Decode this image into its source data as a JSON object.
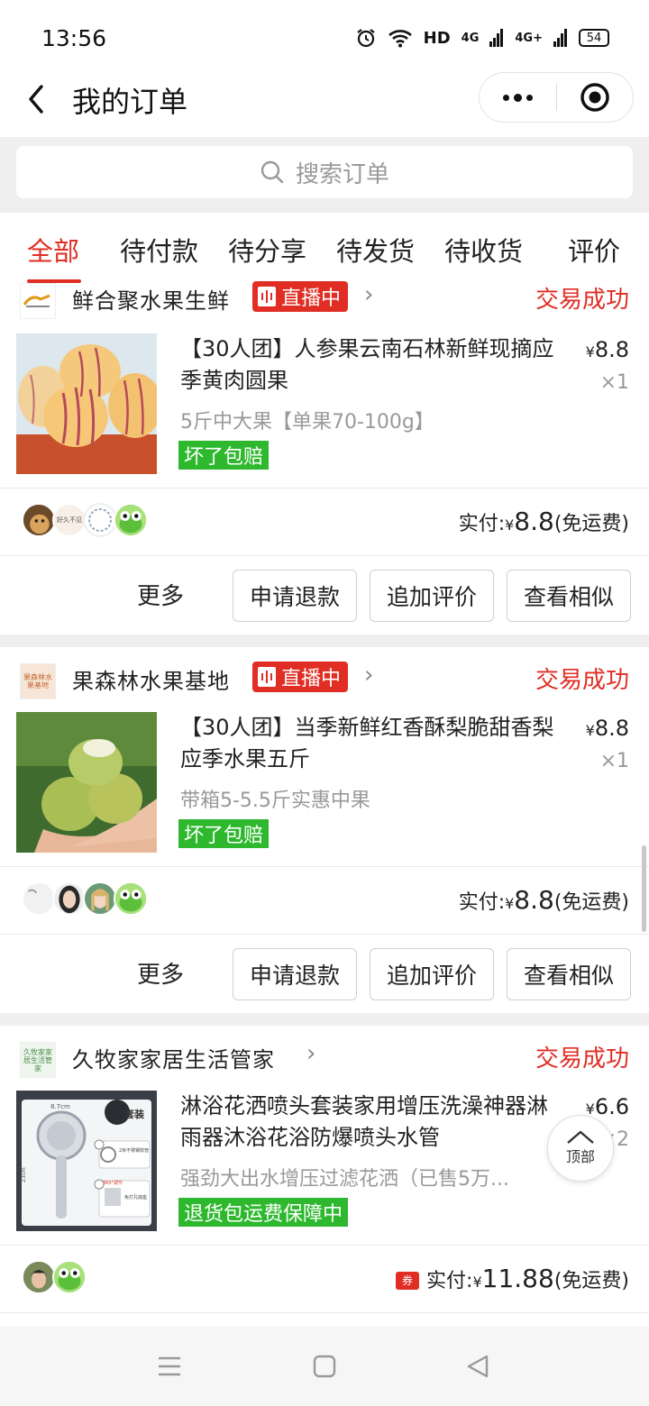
{
  "status_bar": {
    "time": "13:56",
    "hd": "HD",
    "net1": "4G",
    "net2": "4G+",
    "battery": "54"
  },
  "header": {
    "title": "我的订单"
  },
  "search": {
    "placeholder": "搜索订单"
  },
  "tabs": [
    {
      "label": "全部",
      "active": true
    },
    {
      "label": "待付款"
    },
    {
      "label": "待分享"
    },
    {
      "label": "待发货"
    },
    {
      "label": "待收货"
    },
    {
      "label": "评价"
    }
  ],
  "orders": [
    {
      "shop_name": "鲜合聚水果生鲜",
      "live_label": "直播中",
      "status": "交易成功",
      "title": "【30人团】人参果云南石林新鲜现摘应季黄肉圆果",
      "price_symbol": "¥",
      "price": "8.8",
      "qty": "×1",
      "spec": "5斤中大果【单果70-100g】",
      "tag": "坏了包赔",
      "paid_label": "实付:",
      "paid_amount": "8.8",
      "shipping": "(免运费)",
      "avatar_texts": [
        "",
        "好久不见",
        "",
        ""
      ],
      "buttons": {
        "more": "更多",
        "b1": "申请退款",
        "b2": "追加评价",
        "b3": "查看相似"
      }
    },
    {
      "shop_name": "果森林水果基地",
      "live_label": "直播中",
      "status": "交易成功",
      "title": "【30人团】当季新鲜红香酥梨脆甜香梨应季水果五斤",
      "price_symbol": "¥",
      "price": "8.8",
      "qty": "×1",
      "spec": "带箱5-5.5斤实惠中果",
      "tag": "坏了包赔",
      "paid_label": "实付:",
      "paid_amount": "8.8",
      "shipping": "(免运费)",
      "logo_text": "果森林水果基地",
      "buttons": {
        "more": "更多",
        "b1": "申请退款",
        "b2": "追加评价",
        "b3": "查看相似"
      }
    },
    {
      "shop_name": "久牧家家居生活管家",
      "logo_text": "久牧家家居生活管家",
      "status": "交易成功",
      "title": "淋浴花洒喷头套装家用增压洗澡神器淋雨器沐浴花浴防爆喷头水管",
      "price_symbol": "¥",
      "price": "6.6",
      "qty": "×2",
      "spec": "强劲大出水增压过滤花洒（已售5万...",
      "tag": "退货包运费保障中",
      "coupon": "券",
      "paid_label": "实付:",
      "paid_amount": "11.88",
      "shipping": "(免运费)",
      "thumb_labels": {
        "size": "8.7cm",
        "set": "套装",
        "length": "23cm",
        "hose": "2米不锈钢软管",
        "rotate": "360°调节",
        "mount": "免打孔底座"
      }
    }
  ],
  "to_top": {
    "label": "顶部"
  },
  "colors": {
    "accent": "#e02e24",
    "green": "#2eb82e",
    "bg": "#efefef"
  }
}
